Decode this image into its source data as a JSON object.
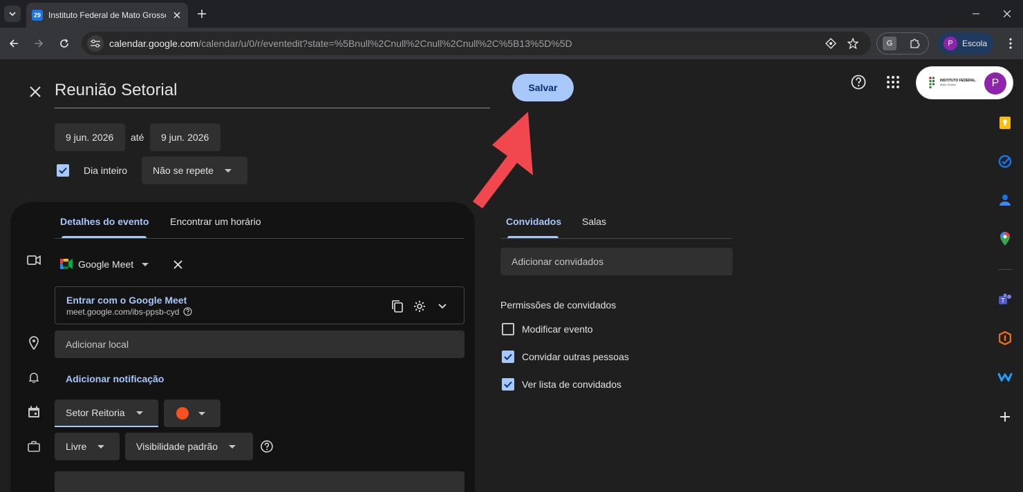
{
  "browser": {
    "tab_title": "Instituto Federal de Mato Grosso",
    "tab_favicon": "29",
    "url_host": "calendar.google.com",
    "url_path": "/calendar/u/0/r/eventedit?state=%5Bnull%2Cnull%2Cnull%2Cnull%2C%5B13%5D%5D",
    "profile_initial": "P",
    "profile_name": "Escola"
  },
  "event": {
    "title": "Reunião Setorial",
    "save_label": "Salvar",
    "start_date": "9 jun. 2026",
    "to_label": "até",
    "end_date": "9 jun. 2026",
    "all_day_label": "Dia inteiro",
    "all_day_checked": true,
    "repeat_value": "Não se repete"
  },
  "account": {
    "org_logo_line1": "INSTITUTO FEDERAL",
    "org_logo_line2": "Mato Grosso",
    "avatar_initial": "P"
  },
  "details": {
    "tabs": [
      {
        "label": "Detalhes do evento",
        "active": true
      },
      {
        "label": "Encontrar um horário",
        "active": false
      }
    ],
    "conference_label": "Google Meet",
    "meet_join_label": "Entrar com o Google Meet",
    "meet_url": "meet.google.com/ibs-ppsb-cyd",
    "location_placeholder": "Adicionar local",
    "add_notification": "Adicionar notificação",
    "calendar_value": "Setor Reitoria",
    "event_color": "#f4511e",
    "availability_value": "Livre",
    "visibility_value": "Visibilidade padrão"
  },
  "guests": {
    "tabs": [
      {
        "label": "Convidados",
        "active": true
      },
      {
        "label": "Salas",
        "active": false
      }
    ],
    "add_placeholder": "Adicionar convidados",
    "permissions_title": "Permissões de convidados",
    "permissions": [
      {
        "label": "Modificar evento",
        "checked": false
      },
      {
        "label": "Convidar outras pessoas",
        "checked": true
      },
      {
        "label": "Ver lista de convidados",
        "checked": true
      }
    ]
  },
  "side_rail": [
    "keep-icon",
    "tasks-icon",
    "contacts-icon",
    "maps-icon",
    "teams-icon",
    "office-icon",
    "webex-icon",
    "add-icon"
  ],
  "colors": {
    "accent": "#a8c7fa",
    "annotation_arrow": "#f0484e"
  }
}
